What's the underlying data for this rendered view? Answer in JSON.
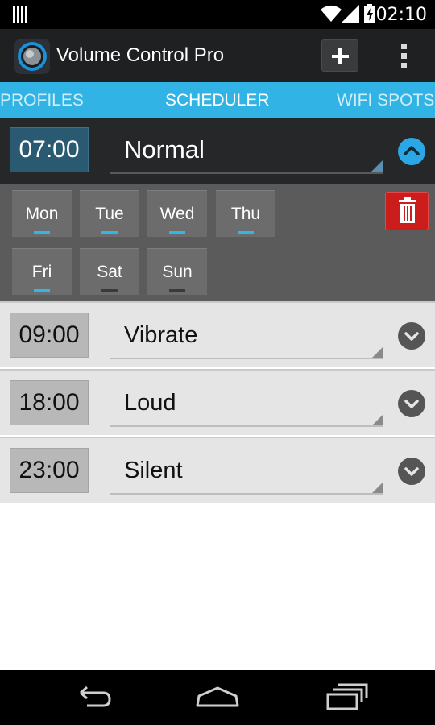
{
  "status_bar": {
    "time": "02:10",
    "icons": [
      "notification-icon",
      "wifi-icon",
      "signal-icon",
      "battery-charging-icon"
    ]
  },
  "action_bar": {
    "title": "Volume Control Pro",
    "app_icon": "knob-icon",
    "actions": [
      "add-icon",
      "overflow-menu-icon"
    ]
  },
  "tabs": [
    {
      "label": "PROFILES",
      "selected": false
    },
    {
      "label": "SCHEDULER",
      "selected": true
    },
    {
      "label": "WIFI SPOTS",
      "selected": false
    }
  ],
  "colors": {
    "accent": "#31b4e5",
    "day_active_indicator": "#33b5e5",
    "day_inactive_indicator": "#3a3a3a",
    "delete": "#cc1d1d"
  },
  "schedules": [
    {
      "time": "07:00",
      "profile": "Normal",
      "expanded": true,
      "days": [
        {
          "label": "Mon",
          "active": true
        },
        {
          "label": "Tue",
          "active": true
        },
        {
          "label": "Wed",
          "active": true
        },
        {
          "label": "Thu",
          "active": true
        },
        {
          "label": "Fri",
          "active": true
        },
        {
          "label": "Sat",
          "active": false
        },
        {
          "label": "Sun",
          "active": false
        }
      ]
    },
    {
      "time": "09:00",
      "profile": "Vibrate",
      "expanded": false
    },
    {
      "time": "18:00",
      "profile": "Loud",
      "expanded": false
    },
    {
      "time": "23:00",
      "profile": "Silent",
      "expanded": false
    }
  ],
  "nav_bar": [
    "back-icon",
    "home-icon",
    "recent-apps-icon"
  ]
}
